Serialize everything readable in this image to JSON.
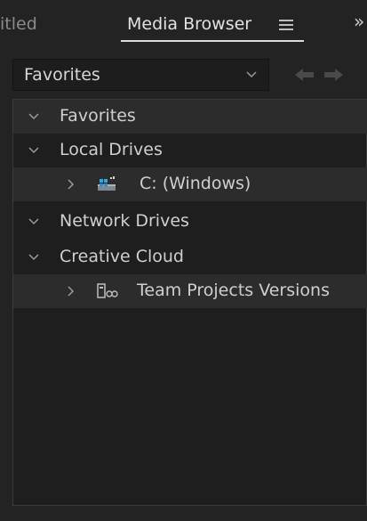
{
  "tabs": {
    "inactive_label": "itled",
    "active_label": "Media Browser",
    "menu_icon": "hamburger-icon",
    "overflow_label": "»"
  },
  "dropdown": {
    "selected": "Favorites",
    "chevron_icon": "chevron-down-icon"
  },
  "nav": {
    "back_icon": "arrow-left-icon",
    "forward_icon": "arrow-right-icon"
  },
  "tree": {
    "items": [
      {
        "label": "Favorites",
        "expanded": true,
        "level": 0
      },
      {
        "label": "Local Drives",
        "expanded": true,
        "level": 0
      },
      {
        "label": "C: (Windows)",
        "expanded": false,
        "level": 1,
        "icon": "windows-drive-icon"
      },
      {
        "label": "Network Drives",
        "expanded": true,
        "level": 0
      },
      {
        "label": "Creative Cloud",
        "expanded": true,
        "level": 0
      },
      {
        "label": "Team Projects Versions",
        "expanded": false,
        "level": 1,
        "icon": "team-projects-icon"
      }
    ]
  },
  "colors": {
    "background": "#232323",
    "panel": "#1e1e1e",
    "selected_row": "#2c2c2c",
    "text": "#cfcfcf"
  }
}
